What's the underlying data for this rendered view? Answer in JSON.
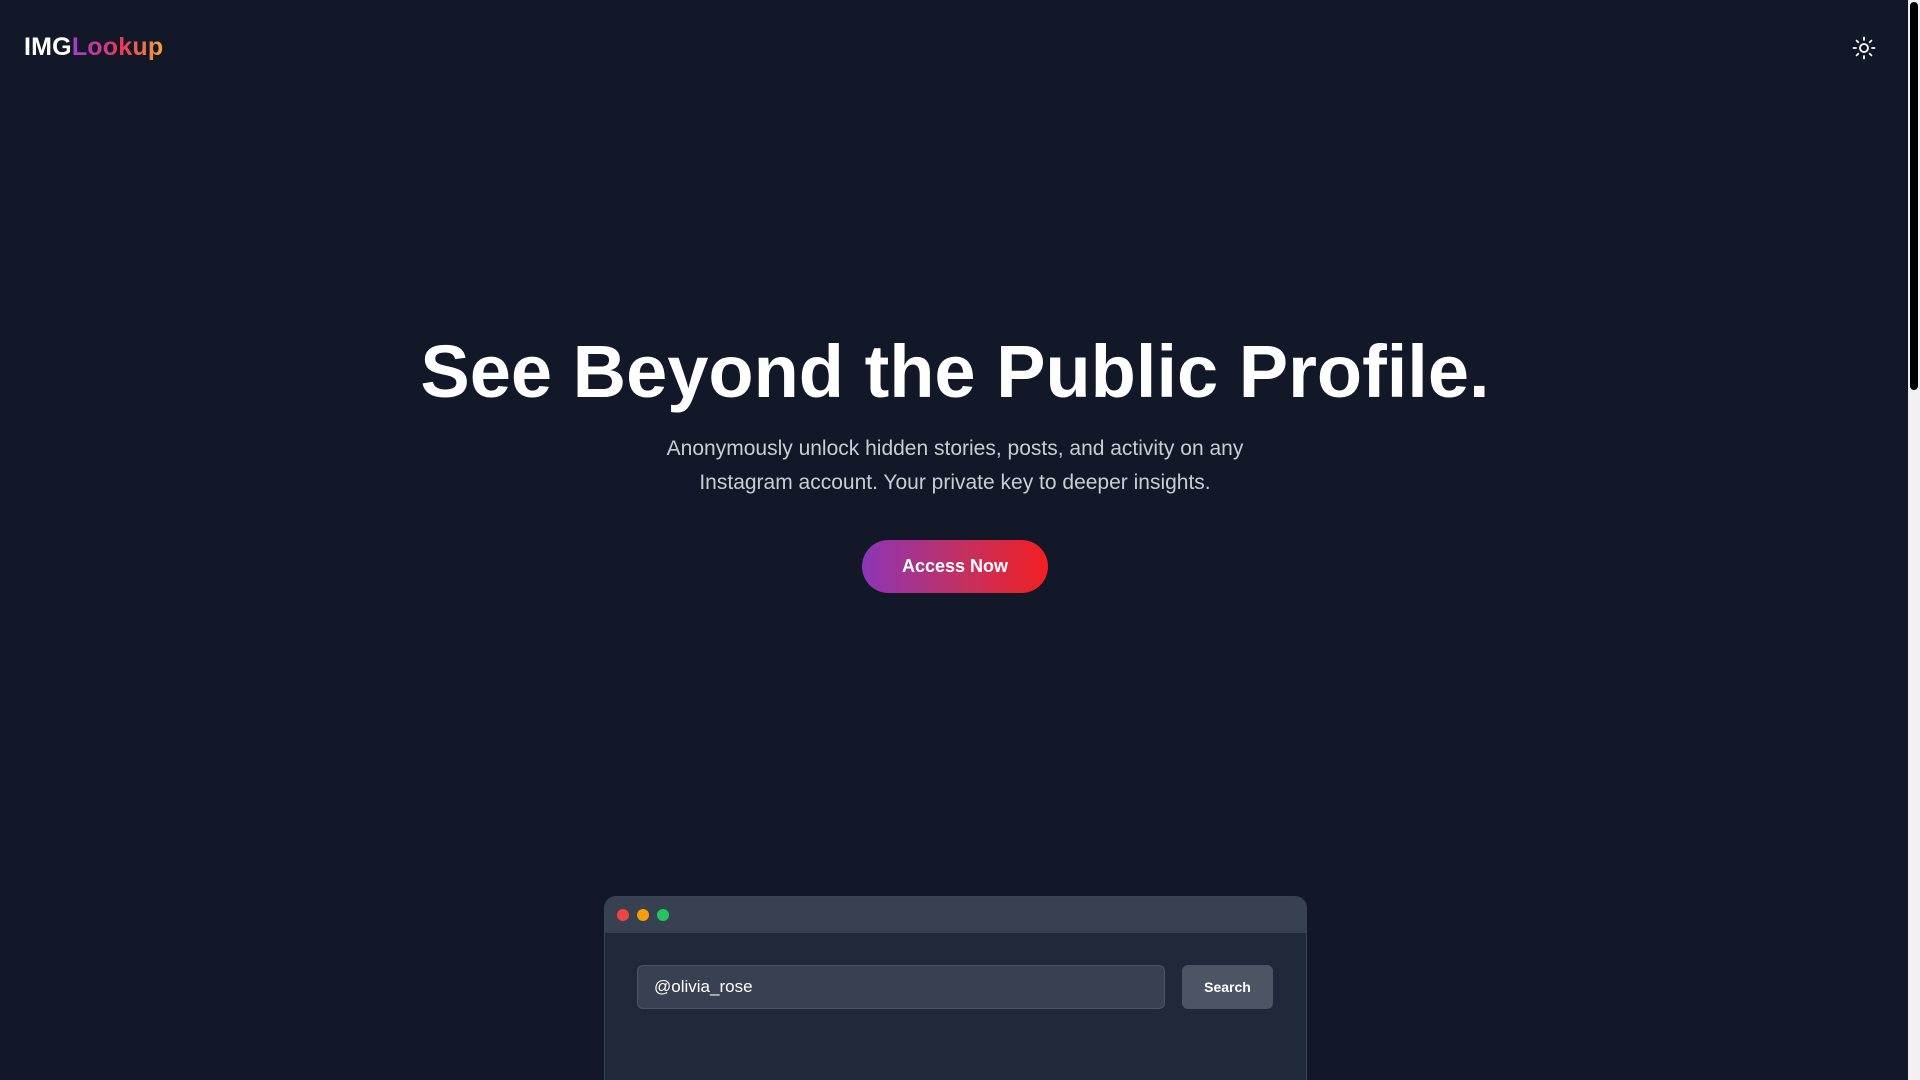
{
  "header": {
    "logo_part1": "IMG",
    "logo_part2": "Lookup",
    "theme_toggle_icon": "sun-icon"
  },
  "hero": {
    "title": "See Beyond the Public Profile.",
    "subtitle": "Anonymously unlock hidden stories, posts, and activity on any Instagram account. Your private key to deeper insights.",
    "cta_label": "Access Now"
  },
  "demo": {
    "search_value": "@olivia_rose",
    "search_button_label": "Search"
  },
  "colors": {
    "background": "#121827",
    "cta_gradient_start": "#8b36b8",
    "cta_gradient_end": "#f21f22",
    "logo_gradient_start": "#a53bd0",
    "logo_gradient_end": "#f6a43b"
  }
}
